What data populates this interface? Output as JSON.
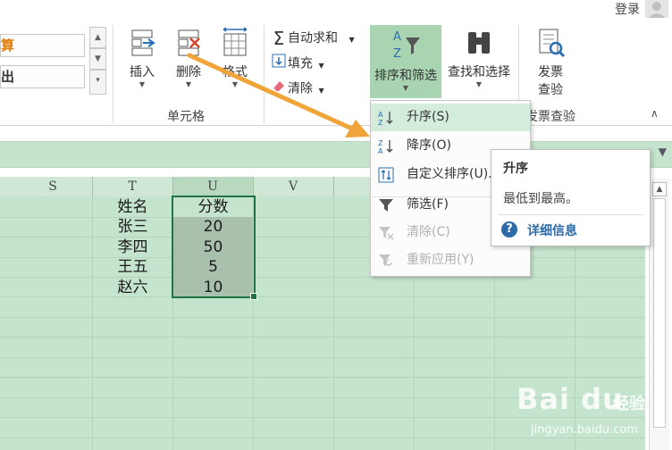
{
  "top": {
    "login": "登录"
  },
  "ribbon": {
    "style_box_1": "算",
    "style_box_2": "出",
    "insert_label": "插入",
    "delete_label": "删除",
    "format_label": "格式",
    "autosum_label": "自动求和",
    "fill_label": "填充",
    "clear_label": "清除",
    "sort_filter_label": "排序和筛选",
    "find_select_label": "查找和选择",
    "invoice_line1": "发票",
    "invoice_line2": "查验",
    "group_cells": "单元格",
    "group_invoice": "发票查验"
  },
  "sheet": {
    "columns": [
      "S",
      "T",
      "U",
      "V"
    ],
    "names": [
      "姓名",
      "张三",
      "李四",
      "王五",
      "赵六"
    ],
    "scores": [
      "分数",
      "20",
      "50",
      "5",
      "10"
    ]
  },
  "menu": {
    "items": [
      {
        "label": "升序(S)",
        "icon": "sort-ascending-icon",
        "enabled": true
      },
      {
        "label": "降序(O)",
        "icon": "sort-descending-icon",
        "enabled": true
      },
      {
        "label": "自定义排序(U)...",
        "icon": "custom-sort-icon",
        "enabled": true
      },
      {
        "label": "筛选(F)",
        "icon": "filter-icon",
        "enabled": true
      },
      {
        "label": "清除(C)",
        "icon": "clear-filter-icon",
        "enabled": false
      },
      {
        "label": "重新应用(Y)",
        "icon": "reapply-icon",
        "enabled": false
      }
    ]
  },
  "tooltip": {
    "title": "升序",
    "description": "最低到最高。",
    "help": "详细信息"
  },
  "watermark": {
    "logo": "Bai du",
    "cn": "经验",
    "url": "jingyan.baidu.com"
  },
  "colors": {
    "sheet_bg": "#c5e4cd",
    "selection_border": "#217346",
    "sort_button_active": "#a9d4b2",
    "arrow": "#f0a43a"
  }
}
